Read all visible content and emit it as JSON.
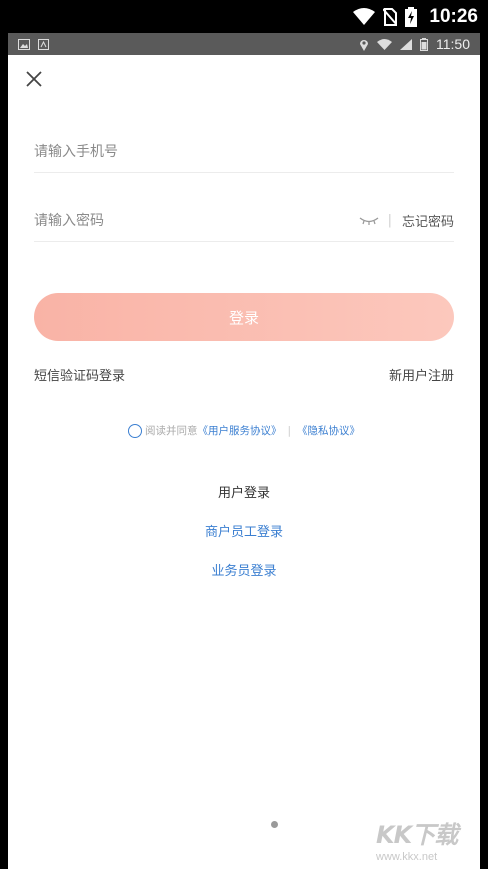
{
  "outer_status": {
    "time": "10:26"
  },
  "inner_status": {
    "time": "11:50"
  },
  "form": {
    "phone_placeholder": "请输入手机号",
    "password_placeholder": "请输入密码",
    "separator": "|",
    "forgot_label": "忘记密码",
    "login_label": "登录"
  },
  "links": {
    "sms_login": "短信验证码登录",
    "register": "新用户注册"
  },
  "agreement": {
    "prefix": "阅读并同意",
    "service": "《用户服务协议》",
    "separator": "|",
    "privacy": "《隐私协议》"
  },
  "roles": {
    "current": "用户登录",
    "merchant": "商户员工登录",
    "salesman": "业务员登录"
  },
  "watermark": {
    "logo": "KK下载",
    "url": "www.kkx.net"
  },
  "colors": {
    "accent_blue": "#3b7fd1",
    "login_button_start": "#f9b3a6",
    "login_button_end": "#fcc8bd"
  }
}
